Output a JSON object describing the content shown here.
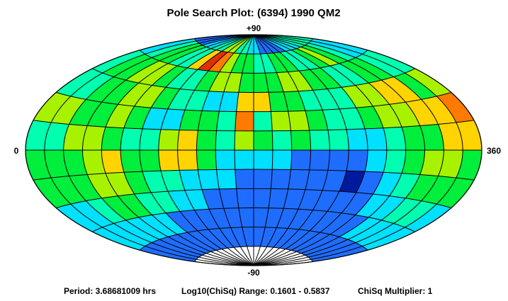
{
  "chart_data": {
    "type": "heatmap",
    "projection": "aitoff",
    "title": "Pole Search Plot: (6394) 1990 QM2",
    "axis_labels": {
      "top": "+90",
      "bottom": "-90",
      "left": "0",
      "right": "360"
    },
    "info": {
      "period": "Period: 3.68681009 hrs",
      "range": "Log10(ChiSq) Range: 0.1601 - 0.5837",
      "multiplier": "ChiSq Multiplier: 1"
    },
    "value_range": [
      0.1601,
      0.5837
    ],
    "color_scale": "blue (low) → cyan → green → yellow → orange → red → dark red (high)",
    "grid": {
      "lon_step_deg": 15,
      "lat_step_deg": 15
    },
    "latitude_bands": [
      75,
      60,
      45,
      30,
      15,
      0,
      -15,
      -30,
      -45,
      -60,
      -75
    ],
    "color_levels": [
      [
        1,
        1,
        1,
        2,
        2,
        3,
        3,
        5,
        5,
        3,
        3,
        2,
        2,
        1,
        1,
        1,
        1,
        2,
        2,
        2,
        3,
        3,
        3,
        3
      ],
      [
        2,
        3,
        4,
        4,
        3,
        3,
        6,
        8,
        7,
        5,
        4,
        4,
        3,
        3,
        4,
        4,
        3,
        3,
        4,
        5,
        4,
        3,
        2,
        2
      ],
      [
        3,
        4,
        4,
        5,
        5,
        4,
        3,
        3,
        4,
        5,
        5,
        4,
        4,
        4,
        5,
        5,
        4,
        4,
        3,
        3,
        4,
        4,
        3,
        3
      ],
      [
        3,
        3,
        4,
        4,
        5,
        5,
        4,
        3,
        3,
        2,
        2,
        6,
        6,
        4,
        4,
        3,
        3,
        3,
        5,
        5,
        6,
        6,
        4,
        5
      ],
      [
        5,
        5,
        4,
        4,
        5,
        4,
        2,
        2,
        4,
        4,
        3,
        7,
        3,
        5,
        5,
        4,
        3,
        3,
        4,
        5,
        5,
        6,
        6,
        7
      ],
      [
        3,
        3,
        5,
        5,
        4,
        3,
        3,
        5,
        6,
        4,
        3,
        5,
        4,
        3,
        4,
        3,
        3,
        2,
        2,
        3,
        4,
        4,
        6,
        6
      ],
      [
        4,
        4,
        4,
        5,
        6,
        4,
        4,
        6,
        6,
        4,
        2,
        2,
        2,
        2,
        1,
        1,
        1,
        1,
        2,
        3,
        4,
        5,
        5,
        4
      ],
      [
        4,
        4,
        4,
        5,
        5,
        4,
        3,
        3,
        2,
        2,
        2,
        1,
        1,
        1,
        1,
        1,
        1,
        0,
        1,
        2,
        3,
        4,
        4,
        4
      ],
      [
        2,
        2,
        3,
        4,
        4,
        3,
        3,
        2,
        2,
        1,
        1,
        1,
        1,
        1,
        1,
        1,
        1,
        1,
        1,
        2,
        2,
        3,
        3,
        2
      ],
      [
        2,
        2,
        2,
        2,
        2,
        2,
        1,
        1,
        1,
        1,
        1,
        1,
        1,
        1,
        1,
        1,
        1,
        1,
        1,
        1,
        2,
        2,
        2,
        2
      ],
      [
        1,
        1,
        1,
        1,
        1,
        1,
        1,
        1,
        1,
        1,
        1,
        1,
        1,
        1,
        1,
        1,
        1,
        1,
        1,
        1,
        1,
        1,
        1,
        1
      ]
    ],
    "palette": [
      "#001a9e",
      "#1f6dff",
      "#00e0ff",
      "#00ffb0",
      "#00ee3c",
      "#a8f200",
      "#ffd400",
      "#ff7a00",
      "#e03000",
      "#8b0000"
    ],
    "colors": {
      "grid_line": "#000000",
      "level_0": "#00008b",
      "level_1": "#1f6dff",
      "level_2": "#00e0ff",
      "level_3": "#00ffb0",
      "level_4": "#00ee3c",
      "level_5": "#a8f200",
      "level_6": "#ffd400",
      "level_7": "#ff7a00",
      "level_8": "#8b0000"
    }
  }
}
